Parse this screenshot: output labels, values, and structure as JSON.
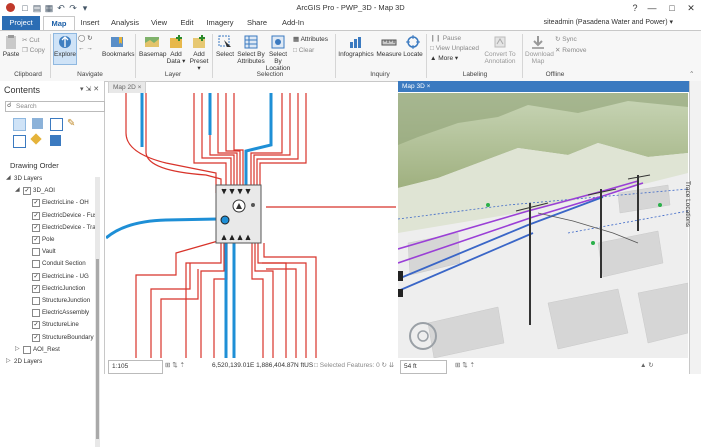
{
  "app": {
    "title": "ArcGIS Pro - PWP_3D - Map 3D",
    "user": "siteadmin (Pasadena Water and Power) ▾",
    "window_controls": [
      "?",
      "—",
      "□",
      "✕"
    ]
  },
  "tabs": [
    "Project",
    "Map",
    "Insert",
    "Analysis",
    "View",
    "Edit",
    "Imagery",
    "Share",
    "Add-In"
  ],
  "ribbon": {
    "clipboard": {
      "paste": "Paste",
      "cut": "Cut",
      "copy": "Copy",
      "group": "Clipboard"
    },
    "navigate": {
      "explore": "Explore",
      "bookmarks": "Bookmarks",
      "group": "Navigate"
    },
    "layer": {
      "basemap": "Basemap",
      "add_data": "Add Data ▾",
      "add_preset": "Add Preset ▾",
      "group": "Layer"
    },
    "selection": {
      "select": "Select",
      "by_attributes": "Select By Attributes",
      "by_location": "Select By Location",
      "attributes": "Attributes",
      "clear": "Clear",
      "group": "Selection"
    },
    "inquiry": {
      "infographics": "Infographics",
      "measure": "Measure",
      "locate": "Locate",
      "group": "Inquiry"
    },
    "labeling": {
      "pause": "Pause",
      "view_unplaced": "View Unplaced",
      "more": "More ▾",
      "convert": "Convert To Annotation",
      "group": "Labeling"
    },
    "offline": {
      "download": "Download Map",
      "sync": "Sync",
      "remove": "Remove",
      "group": "Offline"
    }
  },
  "contents": {
    "title": "Contents",
    "search_placeholder": "Search",
    "drawing_order": "Drawing Order",
    "layers": [
      {
        "label": "3D Layers",
        "indent": 0,
        "checkbox": false,
        "expanded": true
      },
      {
        "label": "3D_AOI",
        "indent": 1,
        "checkbox": true,
        "expanded": true
      },
      {
        "label": "ElectricLine - OH",
        "indent": 2,
        "checkbox": true
      },
      {
        "label": "ElectricDevice - Fuse-",
        "indent": 2,
        "checkbox": true
      },
      {
        "label": "ElectricDevice - Trans",
        "indent": 2,
        "checkbox": true
      },
      {
        "label": "Pole",
        "indent": 2,
        "checkbox": true
      },
      {
        "label": "Vault",
        "indent": 2,
        "checkbox": false
      },
      {
        "label": "Conduit Section",
        "indent": 2,
        "checkbox": false
      },
      {
        "label": "ElectricLine - UG",
        "indent": 2,
        "checkbox": true
      },
      {
        "label": "ElectricJunction",
        "indent": 2,
        "checkbox": true
      },
      {
        "label": "StructureJunction",
        "indent": 2,
        "checkbox": false
      },
      {
        "label": "ElectricAssembly",
        "indent": 2,
        "checkbox": false
      },
      {
        "label": "StructureLine",
        "indent": 2,
        "checkbox": true
      },
      {
        "label": "StructureBoundary",
        "indent": 2,
        "checkbox": true
      },
      {
        "label": "AOI_Rest",
        "indent": 1,
        "checkbox": false
      },
      {
        "label": "2D Layers",
        "indent": 0,
        "checkbox": false
      }
    ]
  },
  "views": {
    "map2d_tab": "Map 2D",
    "map3d_tab": "Map 3D",
    "map2d_scale": "1:105",
    "coords": "6,520,139.01E 1,886,404.87N ftUS",
    "selected": "Selected Features: 0",
    "map3d_scale": "54 ft"
  },
  "right_panel": {
    "trace": "Trace Locations"
  },
  "colors": {
    "accent": "#2b6db4",
    "line_oh": "#d8332a",
    "line_ug": "#1e8fd6",
    "line_3d": "#9a3fd6"
  }
}
